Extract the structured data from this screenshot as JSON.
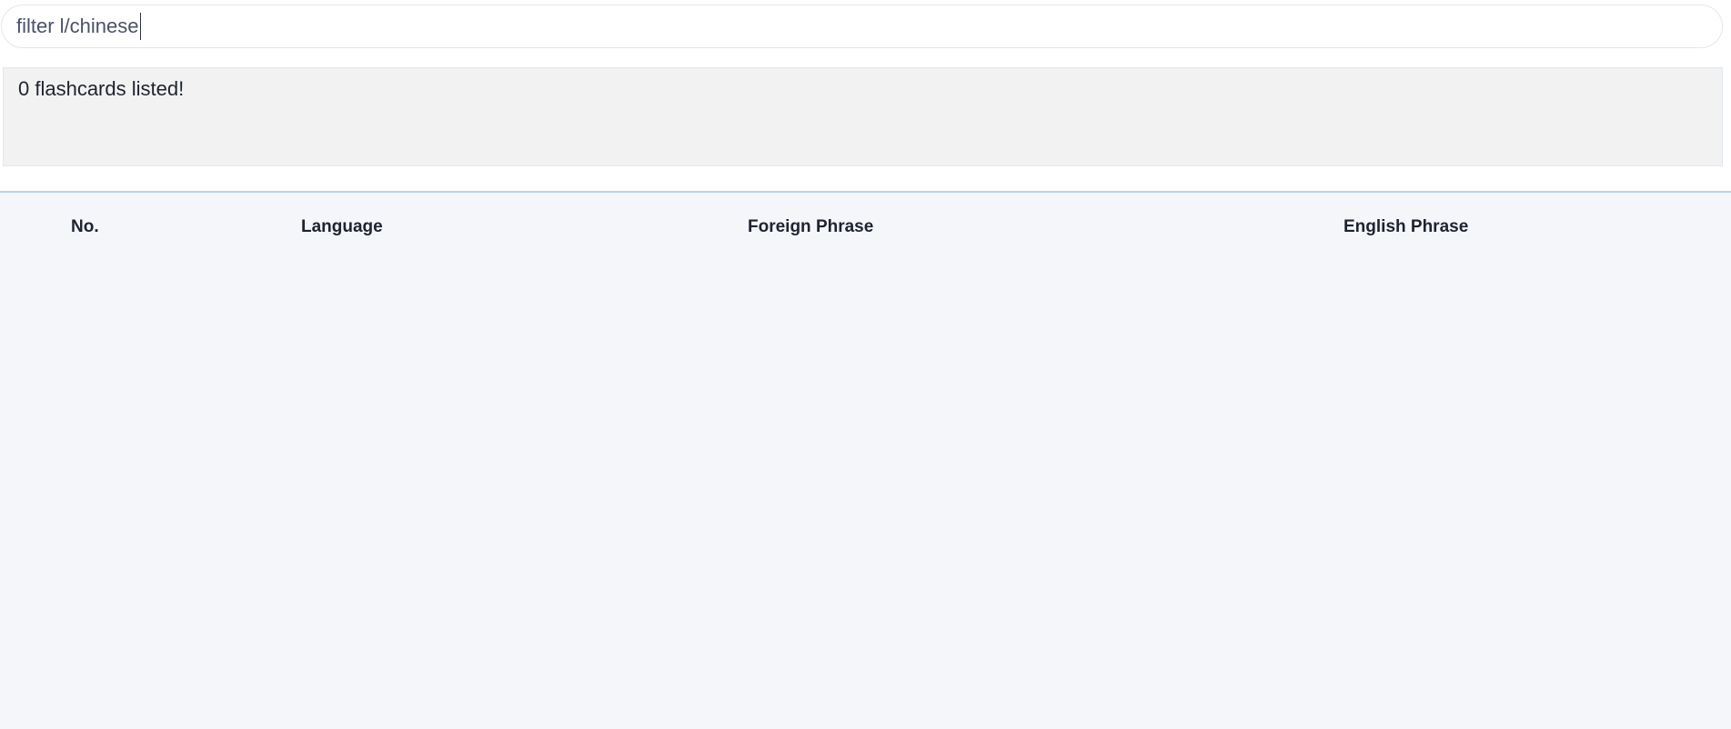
{
  "command_box": {
    "value": "filter l/chinese"
  },
  "result_display": {
    "message": "0 flashcards listed!"
  },
  "flashcard_table": {
    "columns": [
      "No.",
      "Language",
      "Foreign Phrase",
      "English Phrase"
    ],
    "rows": []
  }
}
